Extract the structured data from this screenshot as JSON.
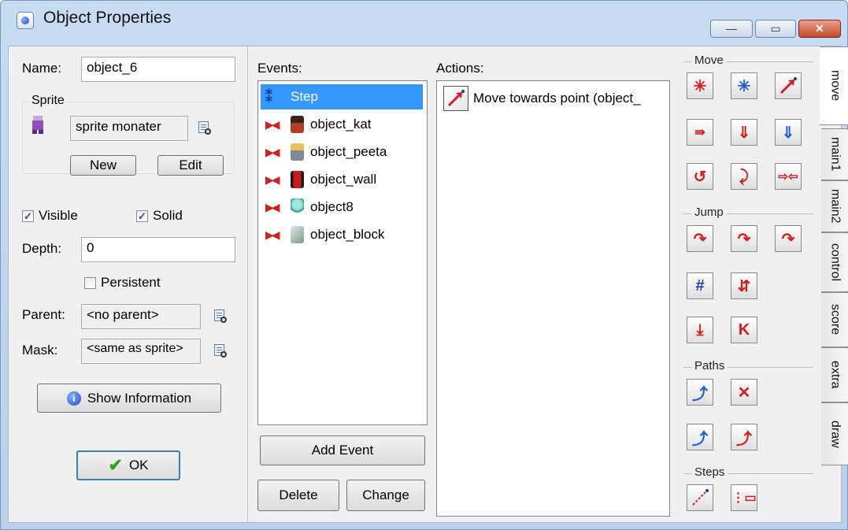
{
  "window": {
    "title": "Object Properties",
    "minimize_glyph": "—",
    "maximize_glyph": "▭",
    "close_glyph": "✕"
  },
  "left": {
    "name_label": "Name:",
    "name_value": "object_6",
    "sprite_group": "Sprite",
    "sprite_value": "sprite monater",
    "new_label": "New",
    "edit_label": "Edit",
    "visible_label": "Visible",
    "visible_checked": true,
    "solid_label": "Solid",
    "solid_checked": true,
    "depth_label": "Depth:",
    "depth_value": "0",
    "persistent_label": "Persistent",
    "persistent_checked": false,
    "parent_label": "Parent:",
    "parent_value": "<no parent>",
    "mask_label": "Mask:",
    "mask_value": "<same as sprite>",
    "show_info_label": "Show Information",
    "ok_label": "OK"
  },
  "events": {
    "header": "Events:",
    "items": [
      {
        "label": "Step",
        "selected": true,
        "icon": "step-icon"
      },
      {
        "label": "object_kat",
        "selected": false,
        "icon": "collision-icon"
      },
      {
        "label": "object_peeta",
        "selected": false,
        "icon": "collision-icon"
      },
      {
        "label": "object_wall",
        "selected": false,
        "icon": "collision-icon"
      },
      {
        "label": "object8",
        "selected": false,
        "icon": "collision-icon"
      },
      {
        "label": "object_block",
        "selected": false,
        "icon": "collision-icon"
      }
    ],
    "add_label": "Add Event",
    "delete_label": "Delete",
    "change_label": "Change"
  },
  "actions": {
    "header": "Actions:",
    "items": [
      {
        "label": "Move towards point (object_",
        "icon": "move-towards-icon"
      }
    ]
  },
  "library": {
    "sections": {
      "move": "Move",
      "jump": "Jump",
      "paths": "Paths",
      "steps": "Steps"
    },
    "tabs": [
      "move",
      "main1",
      "main2",
      "control",
      "score",
      "extra",
      "draw"
    ],
    "active_tab": "move"
  },
  "colors": {
    "selection": "#3399ff",
    "title_bg": "#c6dcf3",
    "close_red": "#c44a2c"
  }
}
